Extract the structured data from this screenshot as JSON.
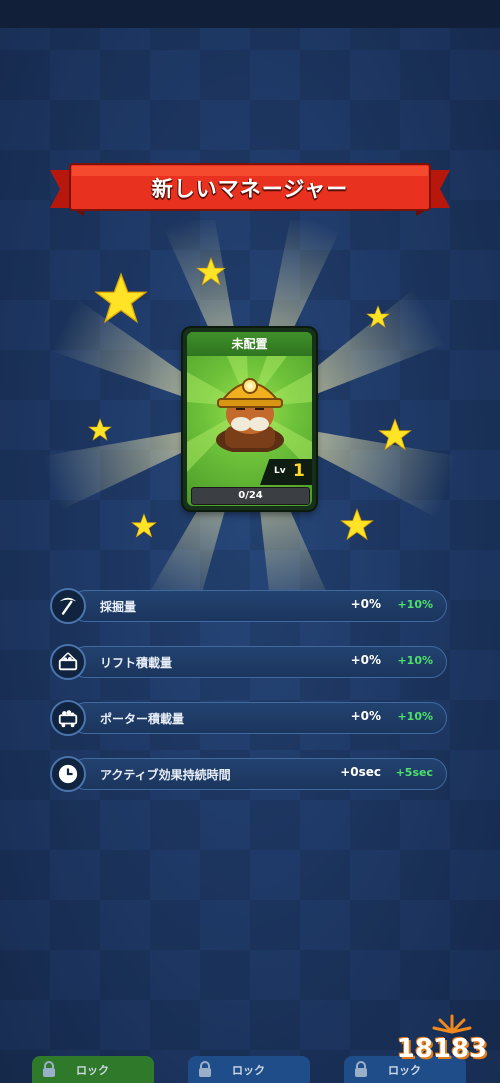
{
  "banner": {
    "title": "新しいマネージャー"
  },
  "card": {
    "status": "未配置",
    "level_label": "Lv",
    "level": "1",
    "progress": "0/24"
  },
  "stats": [
    {
      "icon": "pickaxe-icon",
      "label": "採掘量",
      "value": "+0%",
      "bonus": "+10%"
    },
    {
      "icon": "lift-cart-icon",
      "label": "リフト積載量",
      "value": "+0%",
      "bonus": "+10%"
    },
    {
      "icon": "mine-cart-icon",
      "label": "ポーター積載量",
      "value": "+0%",
      "bonus": "+10%"
    },
    {
      "icon": "clock-icon",
      "label": "アクティブ効果持続時間",
      "value": "+0sec",
      "bonus": "+5sec"
    }
  ],
  "bottom_tabs": [
    {
      "label": "ロック",
      "color": "#2f7a2a"
    },
    {
      "label": "ロック",
      "color": "#1f4d8a"
    },
    {
      "label": "ロック",
      "color": "#1f4d8a"
    }
  ],
  "watermark": {
    "text": "18183"
  },
  "colors": {
    "banner_red": "#e8321f",
    "card_green": "#6ec23a",
    "bonus_green": "#4ee06b",
    "star_yellow": "#ffe326"
  }
}
